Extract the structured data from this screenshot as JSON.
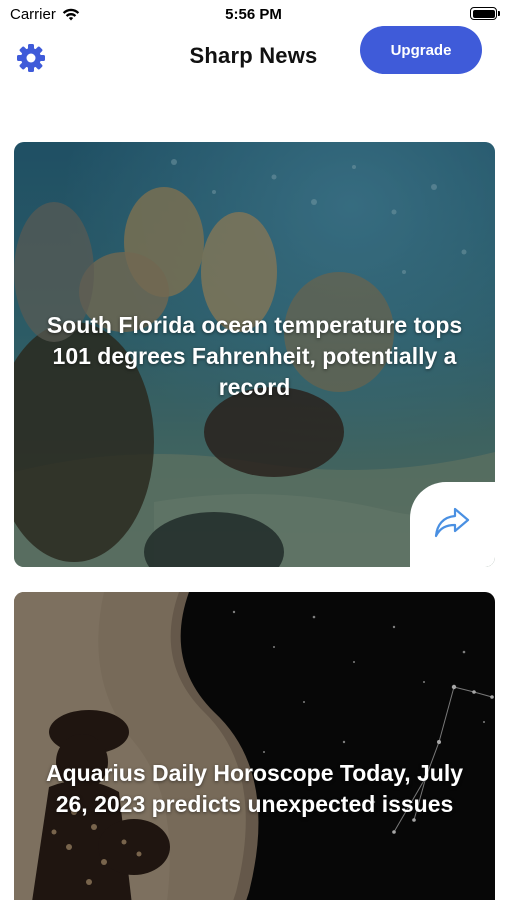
{
  "status_bar": {
    "carrier": "Carrier",
    "time": "5:56 PM"
  },
  "header": {
    "title": "Sharp News",
    "upgrade_label": "Upgrade",
    "settings_icon": "gear-icon"
  },
  "articles": [
    {
      "headline": "South Florida ocean temperature tops 101 degrees Fahrenheit, potentially a record",
      "share_icon": "share-arrow-icon"
    },
    {
      "headline": "Aquarius Daily Horoscope Today, July 26, 2023 predicts unexpected issues"
    }
  ],
  "colors": {
    "accent": "#3f5bd9",
    "share_icon": "#4a90e2"
  }
}
